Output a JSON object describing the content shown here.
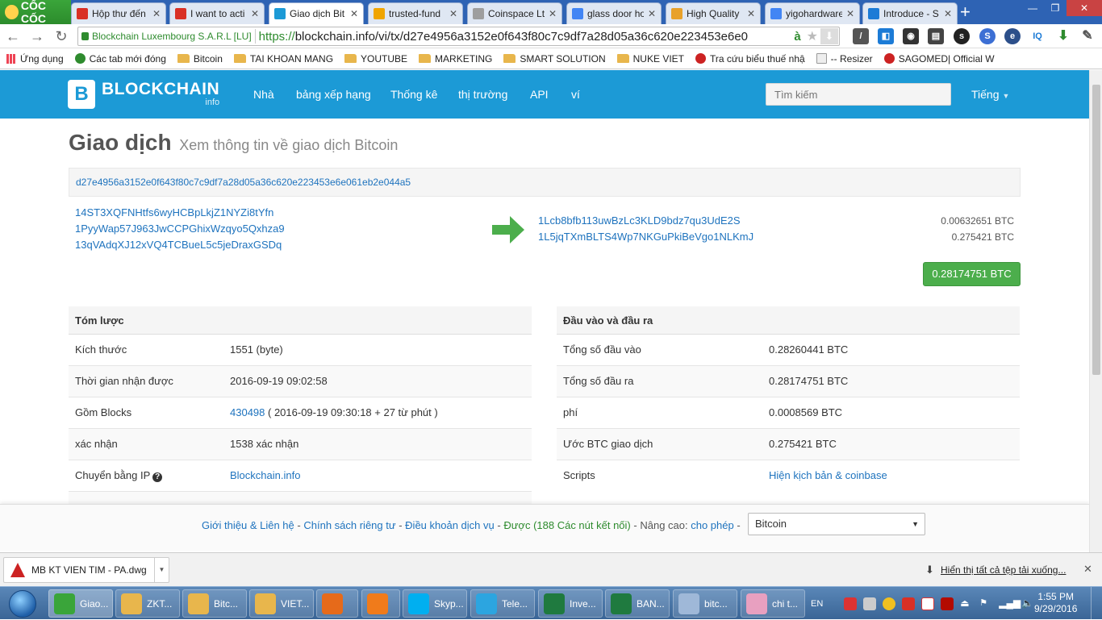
{
  "browser": {
    "brand": "CỐC CỐC",
    "tabs": [
      {
        "label": "Hộp thư đến",
        "icon": "gmail-icon",
        "color": "#d93025"
      },
      {
        "label": "I want to acti",
        "icon": "gmail-icon",
        "color": "#d93025"
      },
      {
        "label": "Giao dịch Bit",
        "icon": "blockchain-icon",
        "color": "#1c9ad6"
      },
      {
        "label": "trusted-fund",
        "icon": "coin-icon",
        "color": "#f0a500"
      },
      {
        "label": "Coinspace Ltd",
        "icon": "loading-icon",
        "color": "#9e9e9e"
      },
      {
        "label": "glass door ho",
        "icon": "google-icon",
        "color": "#4285f4"
      },
      {
        "label": "High Quality",
        "icon": "wrench-icon",
        "color": "#e8a12a"
      },
      {
        "label": "yigohardware",
        "icon": "google-icon",
        "color": "#4285f4"
      },
      {
        "label": "Introduce - S",
        "icon": "site-icon",
        "color": "#1c7bd6"
      }
    ],
    "ev_label": "Blockchain Luxembourg S.A.R.L [LU]",
    "url_scheme": "https://",
    "url_rest": "blockchain.info/vi/tx/d27e4956a3152e0f643f80c7c9df7a28d05a36c620e223453e6e0",
    "bookmarks": [
      {
        "label": "Ứng dụng",
        "icon": "apps-icon"
      },
      {
        "label": "Các tab mới đóng",
        "icon": "history-icon"
      },
      {
        "label": "Bitcoin",
        "icon": "folder-icon"
      },
      {
        "label": "TAI KHOAN MANG",
        "icon": "folder-icon"
      },
      {
        "label": "YOUTUBE",
        "icon": "folder-icon"
      },
      {
        "label": "MARKETING",
        "icon": "folder-icon"
      },
      {
        "label": "SMART SOLUTION",
        "icon": "folder-icon"
      },
      {
        "label": "NUKE VIET",
        "icon": "folder-icon"
      },
      {
        "label": "Tra cứu biểu thuế nhậ",
        "icon": "site-icon"
      },
      {
        "label": "-- Resizer",
        "icon": "page-icon"
      },
      {
        "label": "SAGOMED| Official W",
        "icon": "site-icon"
      }
    ]
  },
  "site": {
    "logo_name": "BLOCKCHAIN",
    "logo_sub": "info",
    "nav": [
      "Nhà",
      "bảng xếp hạng",
      "Thống kê",
      "thị trường",
      "API",
      "ví"
    ],
    "search_placeholder": "Tìm kiếm",
    "language": "Tiếng"
  },
  "page": {
    "title": "Giao dịch",
    "subtitle": "Xem thông tin về giao dịch Bitcoin",
    "tx_hash": "d27e4956a3152e0f643f80c7c9df7a28d05a36c620e223453e6e061eb2e044a5",
    "inputs": [
      "14ST3XQFNHtfs6wyHCBpLkjZ1NYZi8tYfn",
      "1PyyWap57J963JwCCPGhixWzqyo5Qxhza9",
      "13qVAdqXJ12xVQ4TCBueL5c5jeDraxGSDq"
    ],
    "outputs": [
      {
        "address": "1Lcb8bfb113uwBzLc3KLD9bdz7qu3UdE2S",
        "amount": "0.00632651 BTC"
      },
      {
        "address": "1L5jqTXmBLTS4Wp7NKGuPkiBeVgo1NLKmJ",
        "amount": "0.275421 BTC"
      }
    ],
    "total": "0.28174751 BTC",
    "summary": {
      "heading": "Tóm lược",
      "rows": [
        {
          "key": "Kích thước",
          "value": "1551 (byte)"
        },
        {
          "key": "Thời gian nhận được",
          "value": "2016-09-19 09:02:58"
        },
        {
          "key": "Gồm Blocks",
          "link": "430498",
          "value": " ( 2016-09-19 09:30:18 + 27 từ phút )"
        },
        {
          "key": "xác nhận",
          "value": "1538 xác nhận"
        },
        {
          "key": "Chuyển bằng IP",
          "link": "Blockchain.info"
        }
      ]
    },
    "io": {
      "heading": "Đầu vào và đầu ra",
      "rows": [
        {
          "key": "Tổng số đầu vào",
          "value": "0.28260441 BTC"
        },
        {
          "key": "Tổng số đầu ra",
          "value": "0.28174751 BTC"
        },
        {
          "key": "phí",
          "value": "0.0008569 BTC"
        },
        {
          "key": "Ước BTC giao dịch",
          "value": "0.275421 BTC"
        },
        {
          "key": "Scripts",
          "link": "Hiện kịch bản & coinbase"
        }
      ]
    }
  },
  "footer": {
    "about": "Giới thiệu & Liên hệ",
    "privacy": "Chính sách riêng tư",
    "terms": "Điều khoản dịch vụ",
    "status": "Được (188 Các nút kết nối)",
    "advanced_label": "Nâng cao:",
    "advanced_link": "cho phép",
    "sep": "-",
    "network": "Bitcoin"
  },
  "downloads": {
    "file": "MB KT VIEN TIM - PA.dwg",
    "show_all": "Hiển thị tất cả tệp tải xuống..."
  },
  "taskbar": {
    "items": [
      {
        "label": "Giao...",
        "color": "#3aa53a"
      },
      {
        "label": "ZKT...",
        "color": "#e8b64c"
      },
      {
        "label": "Bitc...",
        "color": "#e8b64c"
      },
      {
        "label": "VIET...",
        "color": "#e8b64c"
      },
      {
        "label": "",
        "color": "#e66a1a"
      },
      {
        "label": "",
        "color": "#f07b1b"
      },
      {
        "label": "Skyp...",
        "color": "#00aff0"
      },
      {
        "label": "Tele...",
        "color": "#2ca5e0"
      },
      {
        "label": "Inve...",
        "color": "#1f7a3f"
      },
      {
        "label": "BAN...",
        "color": "#1f7a3f"
      },
      {
        "label": "bitc...",
        "color": "#9fb8d8"
      },
      {
        "label": "chi t...",
        "color": "#e8a0c0"
      }
    ],
    "lang": "EN",
    "time": "1:55 PM",
    "date": "9/29/2016"
  }
}
